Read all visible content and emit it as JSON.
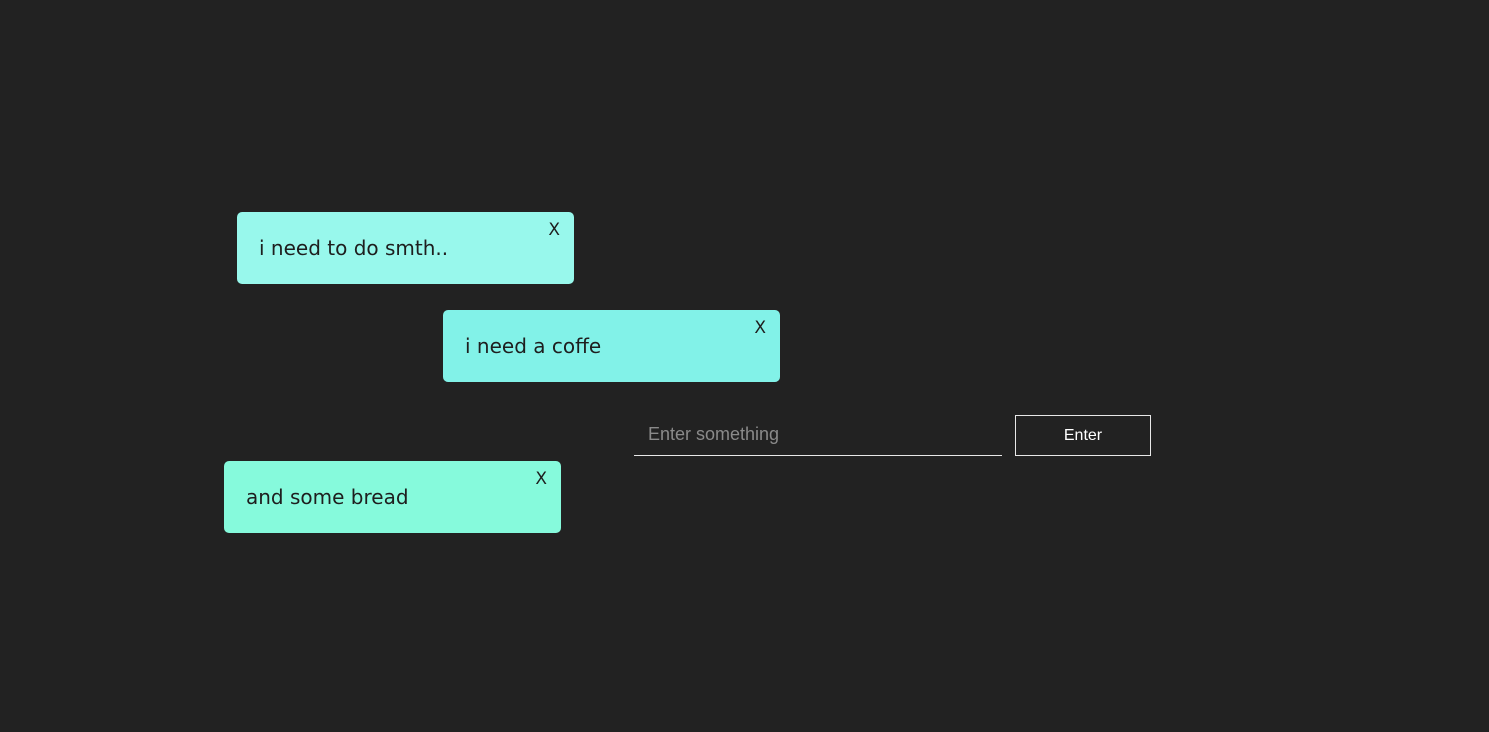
{
  "notes": [
    {
      "text": "i need to do smth..",
      "close_label": "X",
      "color": "#98f8ec"
    },
    {
      "text": "i need a coffe",
      "close_label": "X",
      "color": "#82f2e8"
    },
    {
      "text": "and some bread",
      "close_label": "X",
      "color": "#86fadc"
    }
  ],
  "form": {
    "input_value": "",
    "input_placeholder": "Enter something",
    "button_label": "Enter"
  },
  "colors": {
    "background": "#222222",
    "note_text": "#1e1e1e",
    "form_border": "#e8e8e8"
  }
}
